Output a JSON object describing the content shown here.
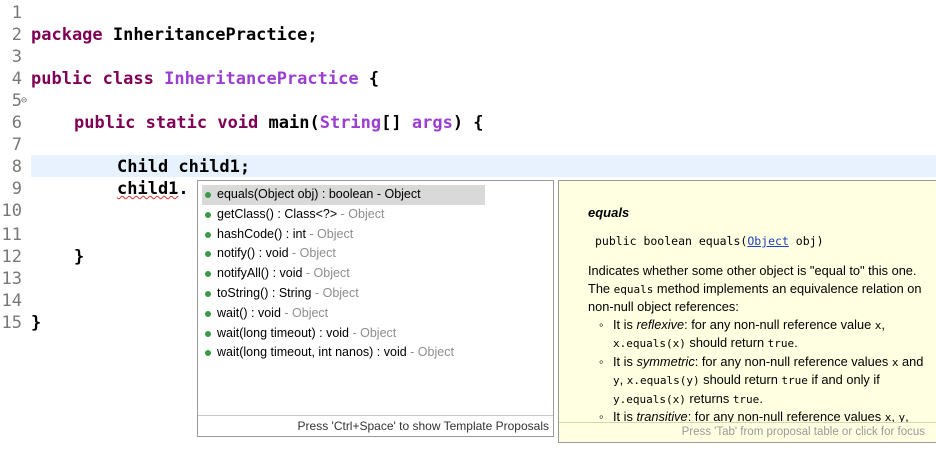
{
  "editor": {
    "lines": [
      {
        "num": "1",
        "text": "package InheritancePractice;"
      },
      {
        "num": "2",
        "text": ""
      },
      {
        "num": "3",
        "text": "public class InheritancePractice {"
      },
      {
        "num": "4",
        "text": ""
      },
      {
        "num": "5",
        "text": "public static void main(String[] args) {"
      },
      {
        "num": "6",
        "text": ""
      },
      {
        "num": "7",
        "text": "Child child1;"
      },
      {
        "num": "8",
        "text": "child1."
      },
      {
        "num": "9",
        "text": ""
      },
      {
        "num": "10",
        "text": ""
      },
      {
        "num": "11",
        "text": "}"
      },
      {
        "num": "12",
        "text": ""
      },
      {
        "num": "13",
        "text": ""
      },
      {
        "num": "14",
        "text": "}"
      },
      {
        "num": "15",
        "text": ""
      }
    ],
    "tokens": {
      "package_kw": "package",
      "package_name": " InheritancePractice;",
      "public_kw": "public",
      "class_kw": "class",
      "class_name": "InheritancePractice",
      "brace_open": " {",
      "static_kw": "static",
      "void_kw": "void",
      "main_name": " main(",
      "string_type": "String",
      "args_text": "[] ",
      "args_name": "args",
      "args_close": ") {",
      "decl": "Child child1;",
      "child_var": "child1",
      "dot": ".",
      "brace_close": "}"
    }
  },
  "proposals": {
    "items": [
      {
        "sig": "equals(Object obj) : boolean",
        "owner": " - Object"
      },
      {
        "sig": "getClass() : Class<?>",
        "owner": " - Object"
      },
      {
        "sig": "hashCode() : int",
        "owner": " - Object"
      },
      {
        "sig": "notify() : void",
        "owner": " - Object"
      },
      {
        "sig": "notifyAll() : void",
        "owner": " - Object"
      },
      {
        "sig": "toString() : String",
        "owner": " - Object"
      },
      {
        "sig": "wait() : void",
        "owner": " - Object"
      },
      {
        "sig": "wait(long timeout) : void",
        "owner": " - Object"
      },
      {
        "sig": "wait(long timeout, int nanos) : void",
        "owner": " - Object"
      }
    ],
    "footer": "Press 'Ctrl+Space' to show Template Proposals"
  },
  "doc": {
    "title": "equals",
    "sig_pre": "public boolean equals(",
    "sig_link": "Object",
    "sig_post": " obj)",
    "p1_a": "Indicates whether some other object is \"equal to\" this one. The ",
    "p1_code": "equals",
    "p1_b": " method implements an equivalence relation on non-null object references:",
    "b1_a": "It is ",
    "b1_em": "reflexive",
    "b1_b": ": for any non-null reference value ",
    "b1_c1": "x",
    "b1_c": ", ",
    "b1_c2": "x.equals(x)",
    "b1_d": " should return ",
    "b1_c3": "true",
    "b1_e": ".",
    "b2_a": "It is ",
    "b2_em": "symmetric",
    "b2_b": ": for any non-null reference values ",
    "b2_c1": "x",
    "b2_c": " and ",
    "b2_c2": "y",
    "b2_d": ", ",
    "b2_c3": "x.equals(y)",
    "b2_e": " should return ",
    "b2_c4": "true",
    "b2_f": " if and only if ",
    "b2_c5": "y.equals(x)",
    "b2_g": " returns ",
    "b2_c6": "true",
    "b2_h": ".",
    "b3_a": "It is ",
    "b3_em": "transitive",
    "b3_b": ": for any non-null reference values ",
    "b3_c1": "x",
    "b3_c": ", ",
    "b3_c2": "y",
    "b3_d": ",",
    "footer": "Press 'Tab' from proposal table or click for focus"
  },
  "colors": {
    "keyword": "#7f0055",
    "type": "#9b3fd0",
    "line_number": "#787878",
    "current_line": "#e8f2fe",
    "doc_bg": "#ffffe1",
    "proposal_dot": "#3a9a47"
  }
}
